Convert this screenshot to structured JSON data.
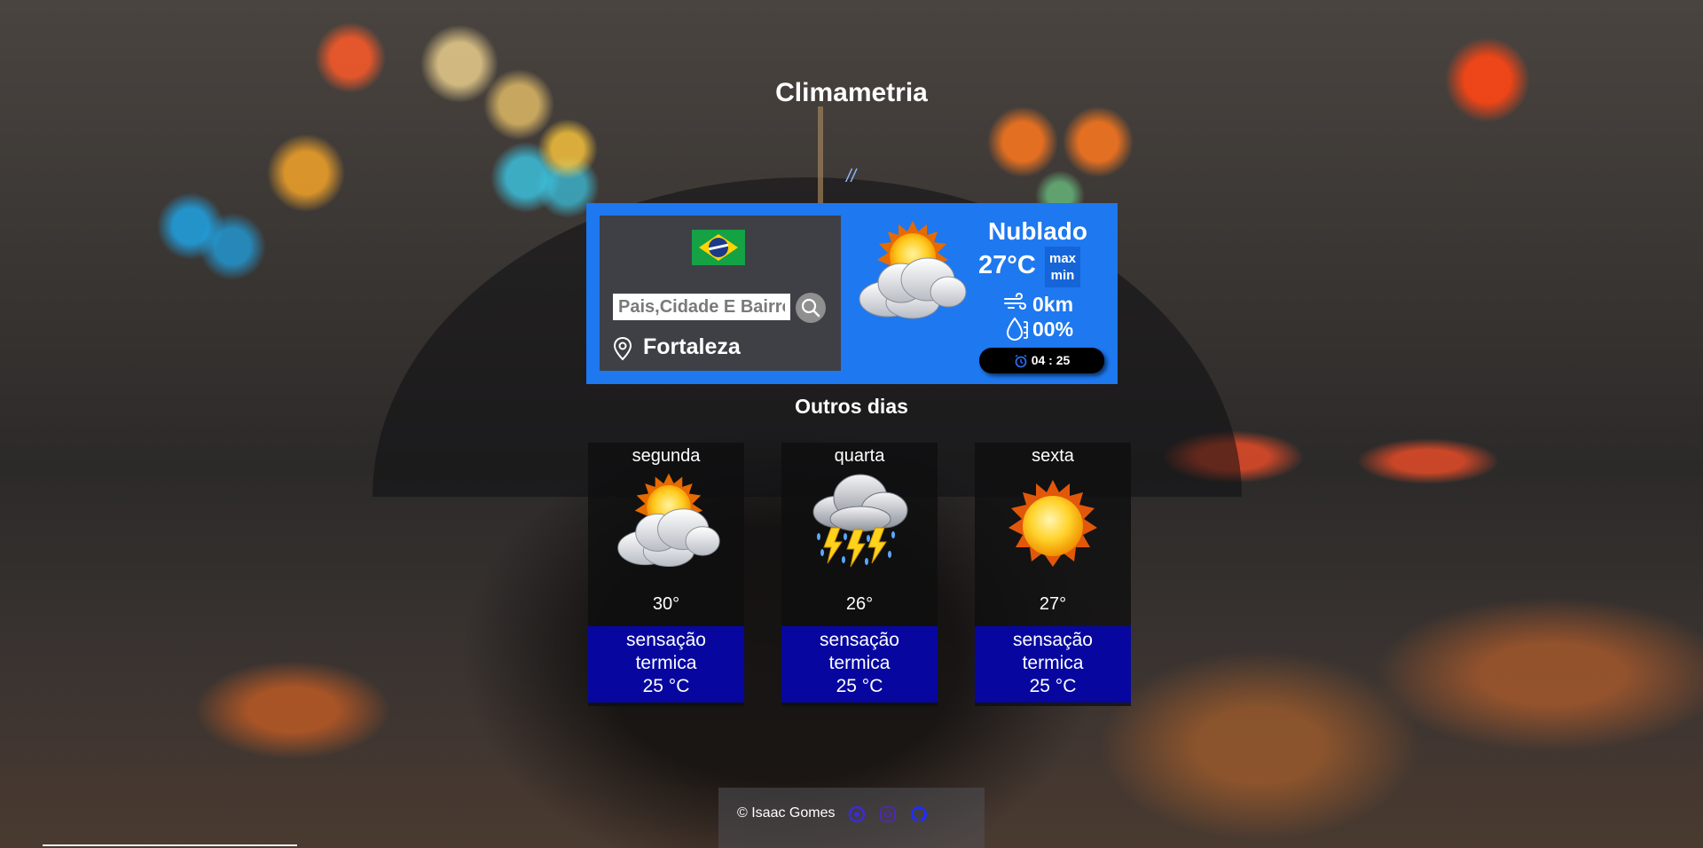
{
  "app": {
    "title": "Climametria",
    "separator": "//"
  },
  "search": {
    "placeholder": "Pais,Cidade E Bairro",
    "value": "",
    "button_icon": "search-icon"
  },
  "current": {
    "country_flag": "brazil-flag",
    "city": "Fortaleza",
    "description": "Nublado",
    "temperature": "27°C",
    "max_label": "max",
    "min_label": "min",
    "wind": "0km",
    "humidity": "00%",
    "time": "04 : 25",
    "icon": "partly-cloudy-icon"
  },
  "forecast": {
    "title": "Outros dias",
    "days": [
      {
        "name": "segunda",
        "temp": "30°",
        "icon": "partly-cloudy-icon",
        "sens_line1": "sensação",
        "sens_line2": "termica",
        "sens_value": "25 °C"
      },
      {
        "name": "quarta",
        "temp": "26°",
        "icon": "thunderstorm-icon",
        "sens_line1": "sensação",
        "sens_line2": "termica",
        "sens_value": "25 °C"
      },
      {
        "name": "sexta",
        "temp": "27°",
        "icon": "sun-icon",
        "sens_line1": "sensação",
        "sens_line2": "termica",
        "sens_value": "25 °C"
      }
    ]
  },
  "footer": {
    "credit": "© Isaac Gomes",
    "links": [
      "linkedin-icon",
      "instagram-icon",
      "github-icon"
    ]
  },
  "colors": {
    "card_blue": "#1e78f0",
    "panel_dark": "#3f3f46",
    "sensation_blue": "#0707a0",
    "github_blue": "#2222ff"
  }
}
